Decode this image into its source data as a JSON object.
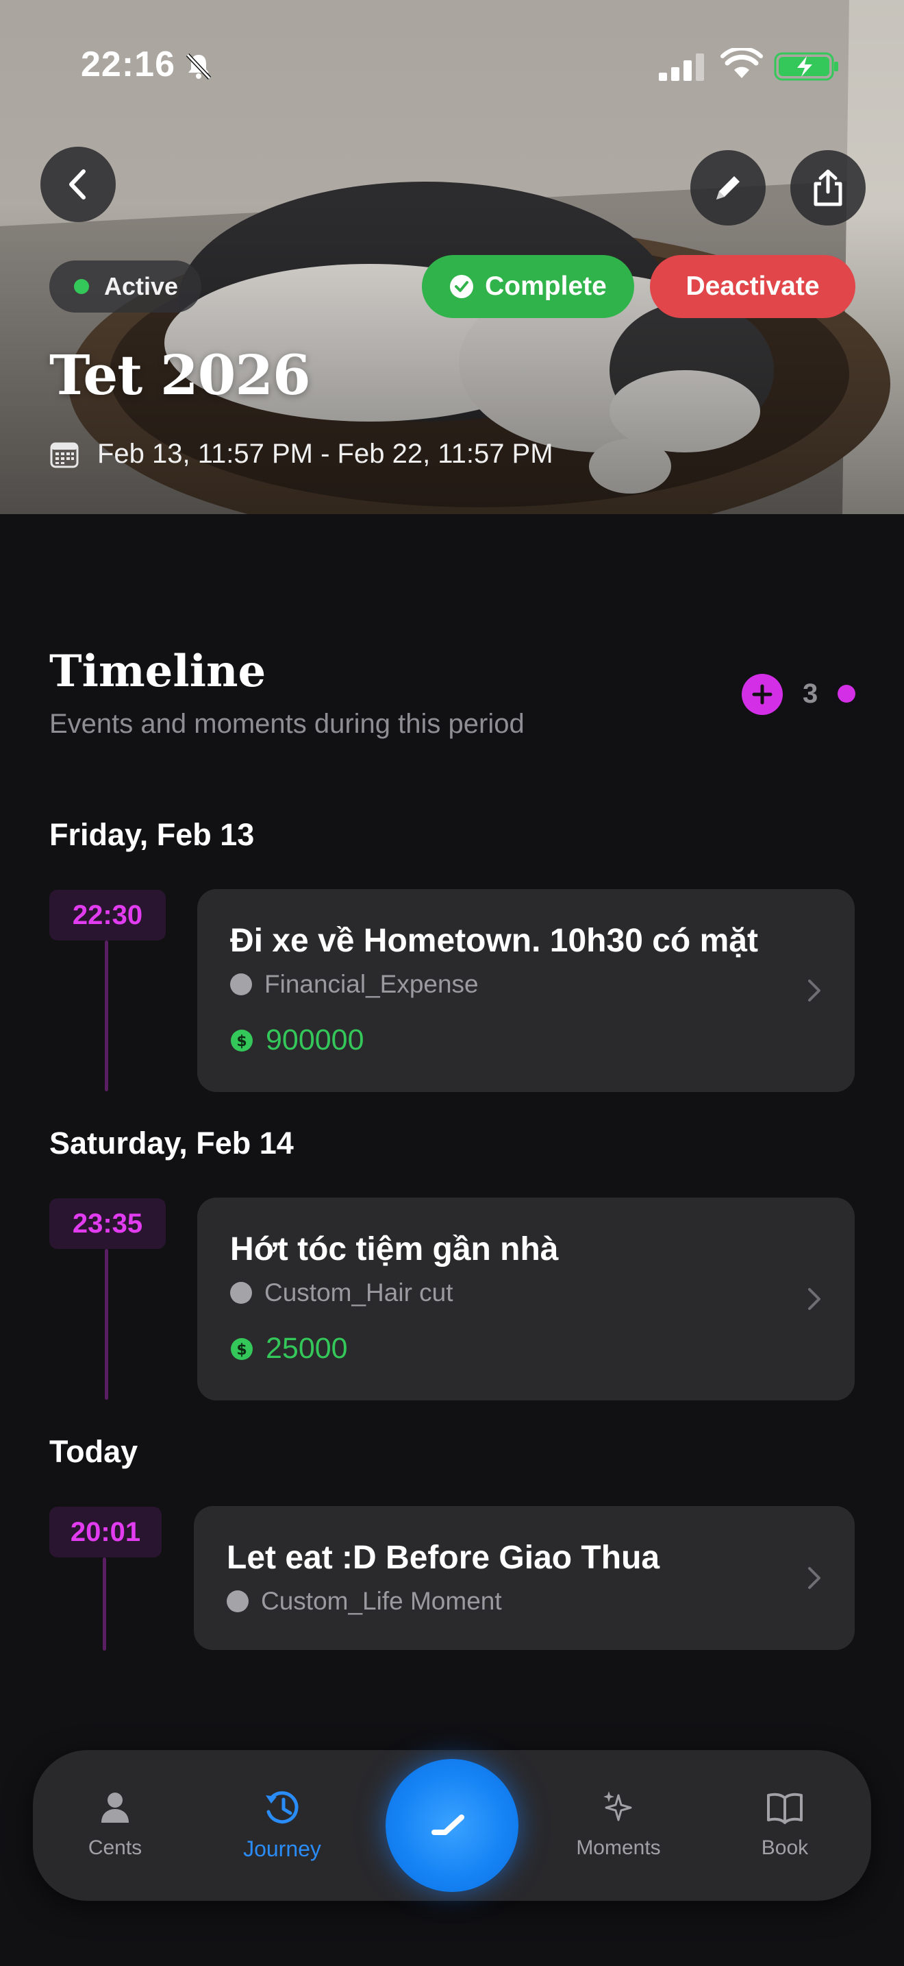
{
  "status_bar": {
    "time": "22:16"
  },
  "hero": {
    "status": "Active",
    "complete_label": "Complete",
    "deactivate_label": "Deactivate",
    "title": "Tet 2026",
    "date_range": "Feb 13, 11:57 PM - Feb 22, 11:57 PM"
  },
  "timeline": {
    "title": "Timeline",
    "subtitle": "Events and moments during this period",
    "count": "3",
    "days": [
      {
        "label": "Friday, Feb 13",
        "events": [
          {
            "time": "22:30",
            "title": "Đi xe về Hometown. 10h30 có mặt",
            "category": "Financial_Expense",
            "amount": "900000"
          }
        ]
      },
      {
        "label": "Saturday, Feb 14",
        "events": [
          {
            "time": "23:35",
            "title": "Hớt tóc tiệm gần nhà",
            "category": "Custom_Hair cut",
            "amount": "25000"
          }
        ]
      },
      {
        "label": "Today",
        "events": [
          {
            "time": "20:01",
            "title": "Let eat :D Before Giao Thua",
            "category": "Custom_Life Moment"
          }
        ]
      }
    ]
  },
  "tabbar": {
    "items": [
      {
        "label": "Cents",
        "icon": "person-icon"
      },
      {
        "label": "Journey",
        "icon": "history-icon",
        "active": true
      },
      {
        "label": "Moments",
        "icon": "sparkles-icon"
      },
      {
        "label": "Book",
        "icon": "book-icon"
      }
    ]
  },
  "colors": {
    "accent_purple": "#d22fe6",
    "success_green": "#34c759",
    "danger_red": "#e0464a",
    "active_blue": "#2a8cf7"
  }
}
